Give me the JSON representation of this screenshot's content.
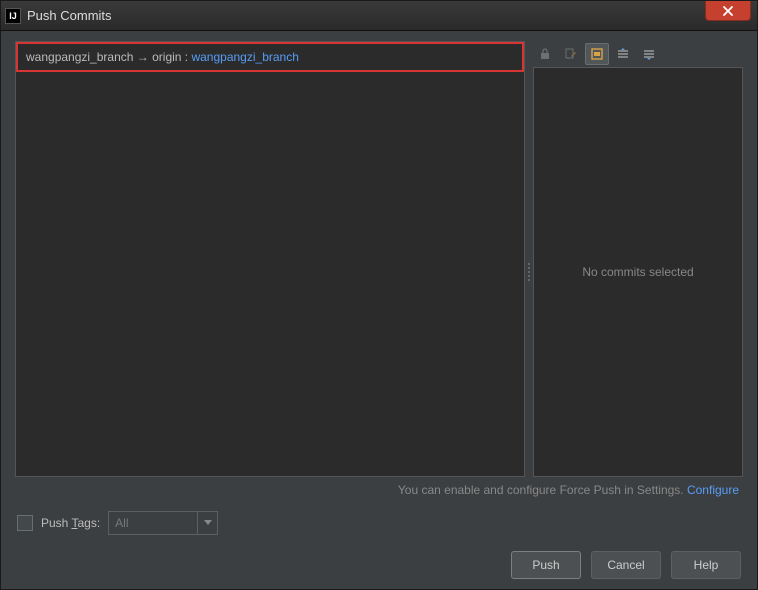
{
  "window": {
    "title": "Push Commits"
  },
  "branch": {
    "local": "wangpangzi_branch",
    "arrow": "→",
    "remote_prefix": "origin : ",
    "remote": "wangpangzi_branch"
  },
  "right_panel": {
    "empty_text": "No commits selected"
  },
  "hint": {
    "text": "You can enable and configure Force Push in Settings. ",
    "link": "Configure"
  },
  "options": {
    "push_tags_label_pre": "Push ",
    "push_tags_key": "T",
    "push_tags_label_post": "ags:",
    "combo_value": "All"
  },
  "buttons": {
    "push": "Push",
    "cancel": "Cancel",
    "help": "Help"
  },
  "toolbar_icons": [
    "lock",
    "edit",
    "wrap",
    "expand",
    "collapse"
  ]
}
